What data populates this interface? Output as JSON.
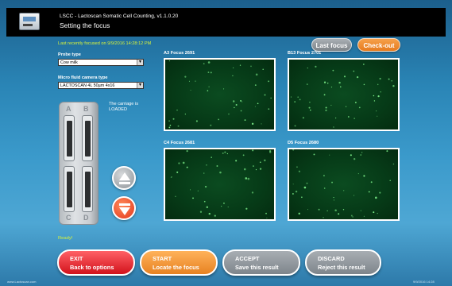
{
  "window": {
    "title": "LSCC - Lactoscan Somatic Cell Counting, v1.1.0.20",
    "subtitle": "Setting the focus"
  },
  "status": {
    "last_focused": "Last recently focused on 9/9/2016 14:28:12 PM",
    "ready": "Ready!"
  },
  "top_buttons": {
    "last_focus": "Last focus",
    "check_out": "Check-out"
  },
  "probe_type": {
    "label": "Probe type",
    "value": "Cow milk"
  },
  "camera_type": {
    "label": "Micro fluid camera type",
    "value": "LACTOSCAN 4L 50µm 4x16"
  },
  "carriage": {
    "status_text": "The carriage is LOADED",
    "letters": [
      "A",
      "B",
      "C",
      "D"
    ]
  },
  "focus_images": [
    {
      "label": "A3 Focus 2691"
    },
    {
      "label": "B13 Focus 2701"
    },
    {
      "label": "C4 Focus 2681"
    },
    {
      "label": "D5 Focus 2680"
    }
  ],
  "actions": {
    "exit": {
      "line1": "EXIT",
      "line2": "Back to options"
    },
    "start": {
      "line1": "START",
      "line2": "Locate the focus"
    },
    "accept": {
      "line1": "ACCEPT",
      "line2": "Save this result"
    },
    "discard": {
      "line1": "DISCARD",
      "line2": "Reject this result"
    }
  },
  "footer": {
    "left": "www.Lactoscan.com",
    "right": "9/9/2016 14:28"
  },
  "colors": {
    "status_text": "#d7f23c",
    "exit": "#e12a2f",
    "start": "#f0922f",
    "check_out": "#ee8a2d",
    "neutral_button": "#8d9399",
    "focus_background": "#063a17",
    "cell_dots": "#7df08a"
  },
  "icons": {
    "app": "analyzer-device-icon",
    "move_up": "arrow-up-icon",
    "move_down": "arrow-down-icon"
  }
}
